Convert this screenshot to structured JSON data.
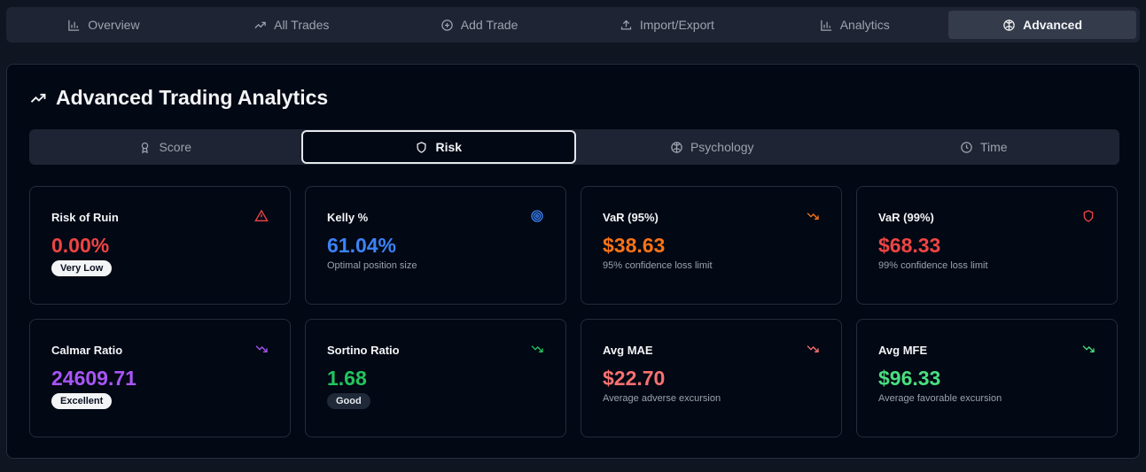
{
  "nav": {
    "tabs": [
      {
        "label": "Overview",
        "icon": "bar-chart-icon"
      },
      {
        "label": "All Trades",
        "icon": "trending-up-icon"
      },
      {
        "label": "Add Trade",
        "icon": "plus-circle-icon"
      },
      {
        "label": "Import/Export",
        "icon": "upload-icon"
      },
      {
        "label": "Analytics",
        "icon": "bar-chart-icon"
      },
      {
        "label": "Advanced",
        "icon": "brain-icon",
        "active": true
      }
    ]
  },
  "panel": {
    "title": "Advanced Trading Analytics",
    "title_icon": "trending-up-icon"
  },
  "subtabs": [
    {
      "label": "Score",
      "icon": "award-icon"
    },
    {
      "label": "Risk",
      "icon": "shield-icon",
      "active": true
    },
    {
      "label": "Psychology",
      "icon": "brain-icon"
    },
    {
      "label": "Time",
      "icon": "clock-icon"
    }
  ],
  "cards": [
    {
      "label": "Risk of Ruin",
      "value": "0.00%",
      "badge": "Very Low",
      "badge_style": "light",
      "icon": "alert-triangle-icon",
      "color": "#ef4444"
    },
    {
      "label": "Kelly %",
      "value": "61.04%",
      "sub": "Optimal position size",
      "icon": "target-icon",
      "color": "#3b82f6"
    },
    {
      "label": "VaR (95%)",
      "value": "$38.63",
      "sub": "95% confidence loss limit",
      "icon": "trending-down-icon",
      "color": "#f97316"
    },
    {
      "label": "VaR (99%)",
      "value": "$68.33",
      "sub": "99% confidence loss limit",
      "icon": "shield-icon",
      "color": "#ef4444"
    },
    {
      "label": "Calmar Ratio",
      "value": "24609.71",
      "badge": "Excellent",
      "badge_style": "light",
      "icon": "trending-down-icon",
      "color": "#a855f7"
    },
    {
      "label": "Sortino Ratio",
      "value": "1.68",
      "badge": "Good",
      "badge_style": "dark",
      "icon": "trending-down-icon",
      "color": "#22c55e"
    },
    {
      "label": "Avg MAE",
      "value": "$22.70",
      "sub": "Average adverse excursion",
      "icon": "trending-down-icon",
      "color": "#f87171"
    },
    {
      "label": "Avg MFE",
      "value": "$96.33",
      "sub": "Average favorable excursion",
      "icon": "trending-down-icon",
      "color": "#4ade80"
    }
  ]
}
